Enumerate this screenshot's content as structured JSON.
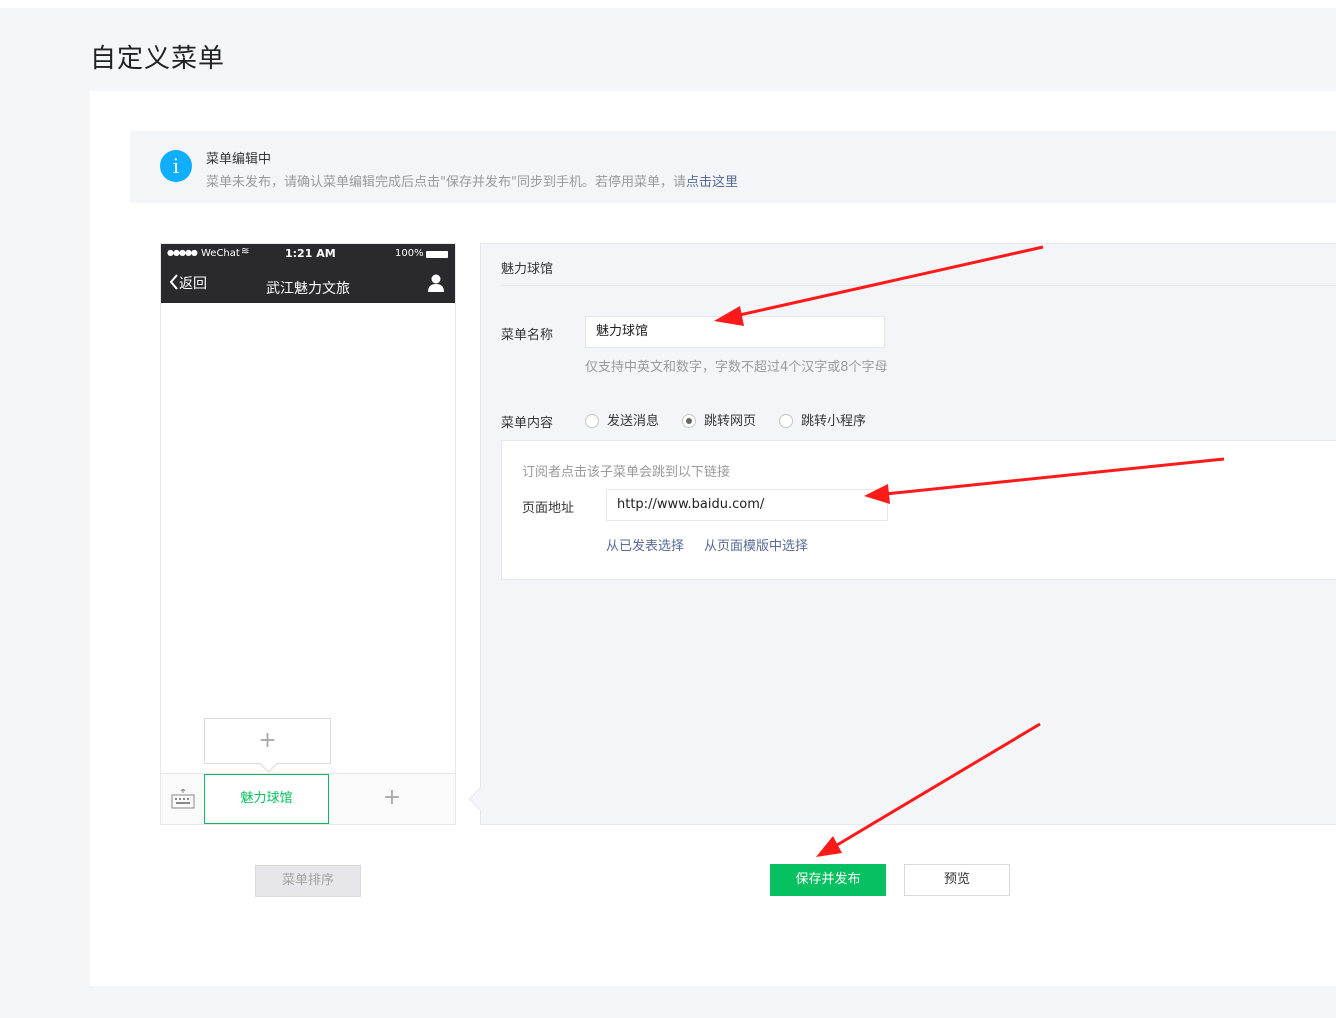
{
  "page_title": "自定义菜单",
  "notice": {
    "icon": "info-icon",
    "icon_glyph": "i",
    "title": "菜单编辑中",
    "desc_prefix": "菜单未发布，请确认菜单编辑完成后点击\"保存并发布\"同步到手机。若停用菜单，请",
    "desc_link": "点击这里"
  },
  "phone": {
    "status": {
      "dots": "●●●●●",
      "carrier": "WeChat",
      "wifi": "≋",
      "time": "1:21 AM",
      "battery": "100%"
    },
    "back_label": "返回",
    "title": "武江魅力文旅",
    "menu_items": [
      "魅力球馆"
    ],
    "add_glyph": "+"
  },
  "editor": {
    "title": "魅力球馆",
    "name_label": "菜单名称",
    "name_value": "魅力球馆",
    "name_tip": "仅支持中英文和数字，字数不超过4个汉字或8个字母",
    "content_label": "菜单内容",
    "content_options": [
      "发送消息",
      "跳转网页",
      "跳转小程序"
    ],
    "content_selected": "跳转网页",
    "url_tip": "订阅者点击该子菜单会跳到以下链接",
    "url_label": "页面地址",
    "url_value": "http://www.baidu.com/",
    "link_published": "从已发表选择",
    "link_template": "从页面模版中选择"
  },
  "buttons": {
    "sort": "菜单排序",
    "save": "保存并发布",
    "preview": "预览"
  },
  "colors": {
    "accent_green": "#07c160",
    "info_blue": "#10aeff",
    "link_blue": "#576b95",
    "annotation_red": "#ff1a1a"
  }
}
